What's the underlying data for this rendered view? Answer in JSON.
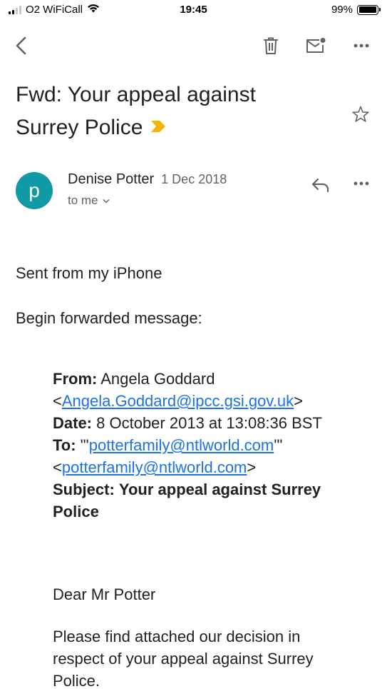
{
  "status_bar": {
    "carrier": "O2 WiFiCall",
    "time": "19:45",
    "battery_percent": "99%",
    "battery_level": 0.99,
    "signal_bars": 2
  },
  "toolbar": {
    "back_icon": "chevron-left-icon",
    "delete_icon": "trash-icon",
    "mark_unread_icon": "mail-unread-icon",
    "more_icon": "more-horizontal-icon"
  },
  "email": {
    "subject": "Fwd: Your appeal against Surrey Police",
    "importance_color": "#f4b400",
    "sender": {
      "initial": "p",
      "avatar_color": "#0f9aa5",
      "name": "Denise Potter",
      "date": "1 Dec 2018",
      "to_label": "to me"
    },
    "body": {
      "signature": "Sent from my iPhone",
      "forward_header": "Begin forwarded message:",
      "forwarded": {
        "from_label": "From:",
        "from_name": "Angela Goddard",
        "from_email": "Angela.Goddard@ipcc.gsi.gov.uk",
        "date_label": "Date:",
        "date_value": "8 October 2013 at 13:08:36 BST",
        "to_label": "To:",
        "to_prefix": "\"'",
        "to_email_1": "potterfamily@ntlworld.com",
        "to_suffix": "'\"",
        "to_email_2": "potterfamily@ntlworld.com",
        "subject_label": "Subject:",
        "subject_value": "Your appeal against Surrey Police"
      },
      "greeting": "Dear Mr Potter",
      "paragraph": "Please find attached our decision in respect of your appeal against Surrey Police."
    }
  },
  "colors": {
    "link": "#1a73e8",
    "icon": "#5f6368",
    "text": "#202124"
  }
}
